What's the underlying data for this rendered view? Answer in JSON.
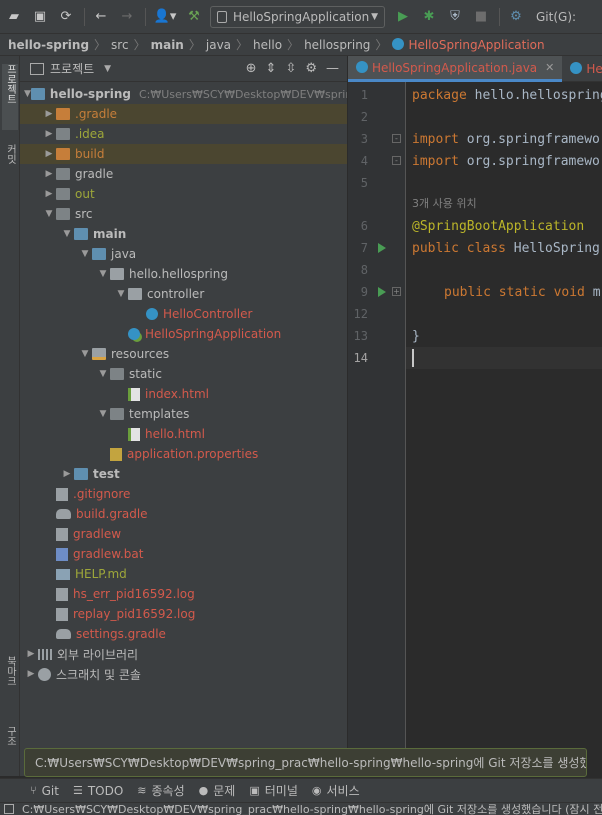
{
  "toolbar": {
    "run_config": "HelloSpringApplication",
    "git_label": "Git(G):"
  },
  "breadcrumb": [
    "hello-spring",
    "src",
    "main",
    "java",
    "hello",
    "hellospring",
    "HelloSpringApplication"
  ],
  "left_strip": {
    "project_tab": "프로젝트",
    "commit_tab": "커밋",
    "bookmarks_tab": "북마크",
    "structure_tab": "구조"
  },
  "project_panel": {
    "title": "프로젝트",
    "tree": [
      {
        "label": "hello-spring",
        "hint": "C:₩Users₩SCY₩Desktop₩DEV₩spring_"
      },
      {
        "label": ".gradle"
      },
      {
        "label": ".idea"
      },
      {
        "label": "build"
      },
      {
        "label": "gradle"
      },
      {
        "label": "out"
      },
      {
        "label": "src"
      },
      {
        "label": "main"
      },
      {
        "label": "java"
      },
      {
        "label": "hello.hellospring"
      },
      {
        "label": "controller"
      },
      {
        "label": "HelloController"
      },
      {
        "label": "HelloSpringApplication"
      },
      {
        "label": "resources"
      },
      {
        "label": "static"
      },
      {
        "label": "index.html"
      },
      {
        "label": "templates"
      },
      {
        "label": "hello.html"
      },
      {
        "label": "application.properties"
      },
      {
        "label": "test"
      },
      {
        "label": ".gitignore"
      },
      {
        "label": "build.gradle"
      },
      {
        "label": "gradlew"
      },
      {
        "label": "gradlew.bat"
      },
      {
        "label": "HELP.md"
      },
      {
        "label": "hs_err_pid16592.log"
      },
      {
        "label": "replay_pid16592.log"
      },
      {
        "label": "settings.gradle"
      },
      {
        "label": "외부 라이브러리"
      },
      {
        "label": "스크래치 및 콘솔"
      }
    ]
  },
  "editor": {
    "tabs": [
      {
        "label": "HelloSpringApplication.java"
      },
      {
        "label": "Hello"
      }
    ],
    "line_numbers": [
      "1",
      "2",
      "3",
      "4",
      "5",
      "6",
      "7",
      "8",
      "9",
      "12",
      "13",
      "14"
    ],
    "code": {
      "l1_kw": "package",
      "l1_rest": " hello.hellospring;",
      "l3_kw": "import",
      "l3_rest": " org.springframework",
      "l4_kw": "import",
      "l4_rest": " org.springframework",
      "usage_hint": "3개 사용 위치",
      "l6_ann": "@SpringBootApplication",
      "l7_kw": "public class",
      "l7_rest": " HelloSpring",
      "l9_kw": "public static void",
      "l9_rest": " m",
      "l13": "}"
    }
  },
  "notification": "C:₩Users₩SCY₩Desktop₩DEV₩spring_prac₩hello-spring₩hello-spring에 Git 저장소를 생성했습니다",
  "bottom_tools": [
    "Git",
    "TODO",
    "종속성",
    "문제",
    "터미널",
    "서비스"
  ],
  "status_text": "C:₩Users₩SCY₩Desktop₩DEV₩spring_prac₩hello-spring₩hello-spring에 Git 저장소를 생성했습니다 (잠시 전"
}
